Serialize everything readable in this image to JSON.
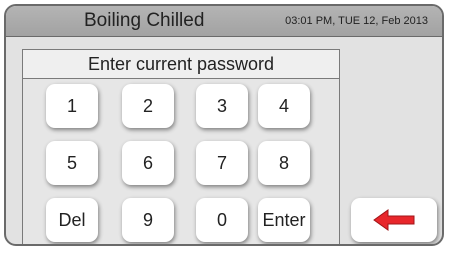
{
  "header": {
    "title": "Boiling Chilled",
    "datetime": "03:01 PM, TUE 12, Feb 2013"
  },
  "prompt": "Enter current password",
  "keypad": {
    "k1": "1",
    "k2": "2",
    "k3": "3",
    "k4": "4",
    "k5": "5",
    "k6": "6",
    "k7": "7",
    "k8": "8",
    "del": "Del",
    "k9": "9",
    "k0": "0",
    "enter": "Enter"
  },
  "back_button": {
    "icon": "arrow-left-icon",
    "color": "#e8262b"
  },
  "colors": {
    "header": "#a8a8a8",
    "panel": "#e2e2e2",
    "frame": "#6a6a6a"
  }
}
